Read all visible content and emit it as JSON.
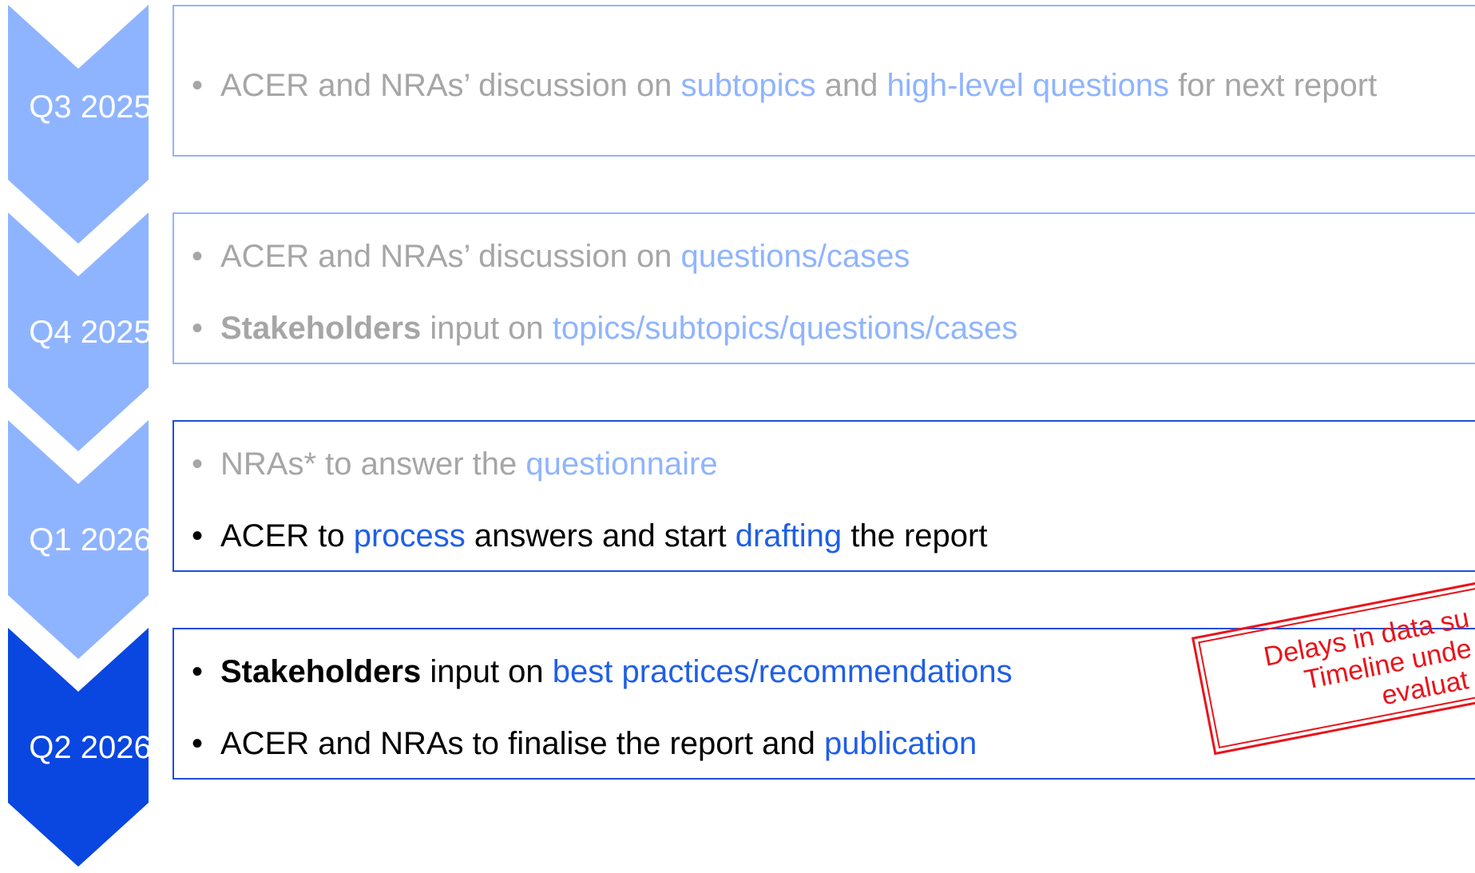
{
  "colors": {
    "chevron_light": "#8fb4ff",
    "chevron_active": "#0a46e0",
    "box_border_light": "#8fb4ff",
    "box_border_active": "#1f4fd8",
    "text_muted": "#a6a6a6",
    "text_strong": "#000000",
    "link_light": "#8fb4ff",
    "link_strong": "#1f5fe6",
    "stamp": "#e8141b"
  },
  "steps": [
    {
      "quarter": "Q3 2025",
      "state": "past",
      "bullets": [
        {
          "segments": [
            {
              "text": "ACER and NRAs’ discussion on ",
              "style": "muted"
            },
            {
              "text": "subtopics",
              "style": "light-link"
            },
            {
              "text": " and ",
              "style": "muted"
            },
            {
              "text": "high-level questions",
              "style": "light-link"
            },
            {
              "text": " for next report",
              "style": "muted"
            }
          ]
        }
      ]
    },
    {
      "quarter": "Q4 2025",
      "state": "past",
      "bullets": [
        {
          "segments": [
            {
              "text": "ACER and NRAs’ discussion on ",
              "style": "muted"
            },
            {
              "text": "questions/cases",
              "style": "light-link"
            }
          ]
        },
        {
          "segments": [
            {
              "text": "Stakeholders",
              "style": "muted bold"
            },
            {
              "text": " input on ",
              "style": "muted"
            },
            {
              "text": "topics/subtopics/questions/cases",
              "style": "light-link"
            }
          ]
        }
      ]
    },
    {
      "quarter": "Q1 2026",
      "state": "current",
      "bullets": [
        {
          "segments": [
            {
              "text": "NRAs* to answer the ",
              "style": "muted"
            },
            {
              "text": "questionnaire",
              "style": "light-link"
            }
          ]
        },
        {
          "segments": [
            {
              "text": "ACER to ",
              "style": "strong"
            },
            {
              "text": "process",
              "style": "link"
            },
            {
              "text": " answers and start ",
              "style": "strong"
            },
            {
              "text": "drafting",
              "style": "link"
            },
            {
              "text": " the report",
              "style": "strong"
            }
          ]
        }
      ]
    },
    {
      "quarter": "Q2 2026",
      "state": "active",
      "bullets": [
        {
          "segments": [
            {
              "text": "Stakeholders",
              "style": "strong bold"
            },
            {
              "text": " input on ",
              "style": "strong"
            },
            {
              "text": "best practices/recommendations",
              "style": "link"
            }
          ]
        },
        {
          "segments": [
            {
              "text": "ACER and NRAs to finalise the report and ",
              "style": "strong"
            },
            {
              "text": "publication",
              "style": "link"
            }
          ]
        }
      ]
    }
  ],
  "bullet_char": "•",
  "stamp": {
    "line1": "Delays in data su",
    "line2": "Timeline unde",
    "line3": "evaluat"
  }
}
